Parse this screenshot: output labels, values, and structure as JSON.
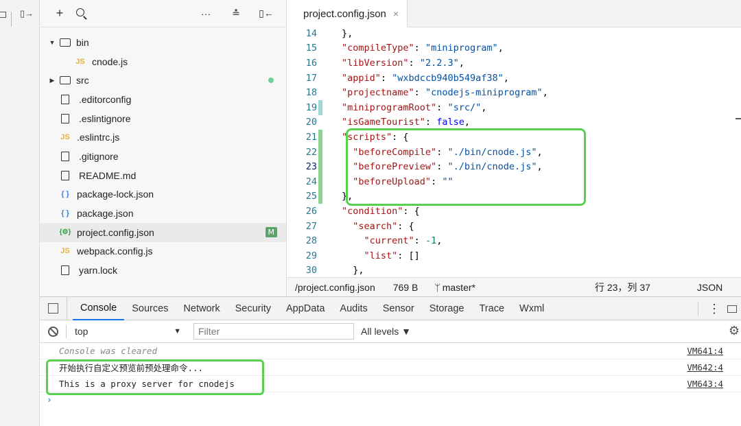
{
  "rail": {
    "icons": [
      "simulator-icon",
      "split-icon"
    ]
  },
  "tree_toolbar": {
    "add": "+",
    "search": "⌕",
    "more": "···",
    "collapse": "≛",
    "panel": "⊏"
  },
  "tree": [
    {
      "name": "bin",
      "type": "folder",
      "expanded": true,
      "indent": 0
    },
    {
      "name": "cnode.js",
      "type": "js",
      "indent": 2
    },
    {
      "name": "src",
      "type": "folder",
      "expanded": false,
      "indent": 0,
      "dot": true
    },
    {
      "name": ".editorconfig",
      "type": "file",
      "indent": 1
    },
    {
      "name": ".eslintignore",
      "type": "file",
      "indent": 1
    },
    {
      "name": ".eslintrc.js",
      "type": "js",
      "indent": 1
    },
    {
      "name": ".gitignore",
      "type": "file",
      "indent": 1
    },
    {
      "name": "README.md",
      "type": "file",
      "indent": 1
    },
    {
      "name": "package-lock.json",
      "type": "json",
      "indent": 1
    },
    {
      "name": "package.json",
      "type": "json",
      "indent": 1
    },
    {
      "name": "project.config.json",
      "type": "cfg",
      "indent": 1,
      "badge": "M",
      "active": true
    },
    {
      "name": "webpack.config.js",
      "type": "js",
      "indent": 1
    },
    {
      "name": "yarn.lock",
      "type": "file",
      "indent": 1
    }
  ],
  "icon_glyphs": {
    "js": "JS",
    "json": "{ }",
    "cfg": "{⚙}"
  },
  "editor": {
    "tab_title": "project.config.json",
    "tab_close": "×",
    "current_line": 23,
    "lines": [
      {
        "n": 14,
        "gut": "",
        "indent": 1,
        "tokens": [
          [
            "p",
            "},"
          ]
        ]
      },
      {
        "n": 15,
        "gut": "",
        "indent": 1,
        "tokens": [
          [
            "k",
            "\"compileType\""
          ],
          [
            "p",
            ": "
          ],
          [
            "s",
            "\"miniprogram\""
          ],
          [
            "p",
            ","
          ]
        ]
      },
      {
        "n": 16,
        "gut": "",
        "indent": 1,
        "tokens": [
          [
            "k",
            "\"libVersion\""
          ],
          [
            "p",
            ": "
          ],
          [
            "s",
            "\"2.2.3\""
          ],
          [
            "p",
            ","
          ]
        ]
      },
      {
        "n": 17,
        "gut": "",
        "indent": 1,
        "tokens": [
          [
            "k",
            "\"appid\""
          ],
          [
            "p",
            ": "
          ],
          [
            "s",
            "\"wxbdccb940b549af38\""
          ],
          [
            "p",
            ","
          ]
        ]
      },
      {
        "n": 18,
        "gut": "",
        "indent": 1,
        "tokens": [
          [
            "k",
            "\"projectname\""
          ],
          [
            "p",
            ": "
          ],
          [
            "s",
            "\"cnodejs-miniprogram\""
          ],
          [
            "p",
            ","
          ]
        ]
      },
      {
        "n": 19,
        "gut": "mod",
        "indent": 1,
        "tokens": [
          [
            "k",
            "\"miniprogramRoot\""
          ],
          [
            "p",
            ": "
          ],
          [
            "s",
            "\"src/\""
          ],
          [
            "p",
            ","
          ]
        ]
      },
      {
        "n": 20,
        "gut": "",
        "indent": 1,
        "tokens": [
          [
            "k",
            "\"isGameTourist\""
          ],
          [
            "p",
            ": "
          ],
          [
            "b",
            "false"
          ],
          [
            "p",
            ","
          ]
        ]
      },
      {
        "n": 21,
        "gut": "add",
        "indent": 1,
        "tokens": [
          [
            "k",
            "\"scripts\""
          ],
          [
            "p",
            ": {"
          ]
        ]
      },
      {
        "n": 22,
        "gut": "add",
        "indent": 2,
        "tokens": [
          [
            "k",
            "\"beforeCompile\""
          ],
          [
            "p",
            ": "
          ],
          [
            "s",
            "\"./bin/cnode.js\""
          ],
          [
            "p",
            ","
          ]
        ]
      },
      {
        "n": 23,
        "gut": "add",
        "indent": 2,
        "tokens": [
          [
            "k",
            "\"beforePreview\""
          ],
          [
            "p",
            ": "
          ],
          [
            "s",
            "\"./bin/cnode.js\""
          ],
          [
            "p",
            ","
          ]
        ]
      },
      {
        "n": 24,
        "gut": "add",
        "indent": 2,
        "tokens": [
          [
            "k",
            "\"beforeUpload\""
          ],
          [
            "p",
            ": "
          ],
          [
            "s",
            "\"\""
          ]
        ]
      },
      {
        "n": 25,
        "gut": "add",
        "indent": 1,
        "tokens": [
          [
            "p",
            "},"
          ]
        ]
      },
      {
        "n": 26,
        "gut": "",
        "indent": 1,
        "tokens": [
          [
            "k",
            "\"condition\""
          ],
          [
            "p",
            ": {"
          ]
        ]
      },
      {
        "n": 27,
        "gut": "",
        "indent": 2,
        "tokens": [
          [
            "k",
            "\"search\""
          ],
          [
            "p",
            ": {"
          ]
        ]
      },
      {
        "n": 28,
        "gut": "",
        "indent": 3,
        "tokens": [
          [
            "k",
            "\"current\""
          ],
          [
            "p",
            ": "
          ],
          [
            "n",
            "-1"
          ],
          [
            "p",
            ","
          ]
        ]
      },
      {
        "n": 29,
        "gut": "",
        "indent": 3,
        "tokens": [
          [
            "k",
            "\"list\""
          ],
          [
            "p",
            ": []"
          ]
        ]
      },
      {
        "n": 30,
        "gut": "",
        "indent": 2,
        "tokens": [
          [
            "p",
            "},"
          ]
        ]
      }
    ]
  },
  "status": {
    "path": "/project.config.json",
    "size": "769 B",
    "branch_icon": "ᛘ",
    "branch": "master*",
    "position": "行 23，列 37",
    "language": "JSON"
  },
  "devtools": {
    "tabs": [
      "Console",
      "Sources",
      "Network",
      "Security",
      "AppData",
      "Audits",
      "Sensor",
      "Storage",
      "Trace",
      "Wxml"
    ],
    "active_tab": "Console",
    "context": "top",
    "context_arrow": "▼",
    "filter_placeholder": "Filter",
    "levels": "All levels ▼",
    "messages": [
      {
        "text": "Console was cleared",
        "src": "VM641:4",
        "cleared": true
      },
      {
        "text": "开始执行自定义预览前预处理命令...",
        "src": "VM642:4"
      },
      {
        "text": "This is a proxy server for cnodejs",
        "src": "VM643:4"
      }
    ],
    "prompt": "›"
  },
  "colors": {
    "highlight": "#55d34f",
    "accent": "#1a73e8"
  }
}
